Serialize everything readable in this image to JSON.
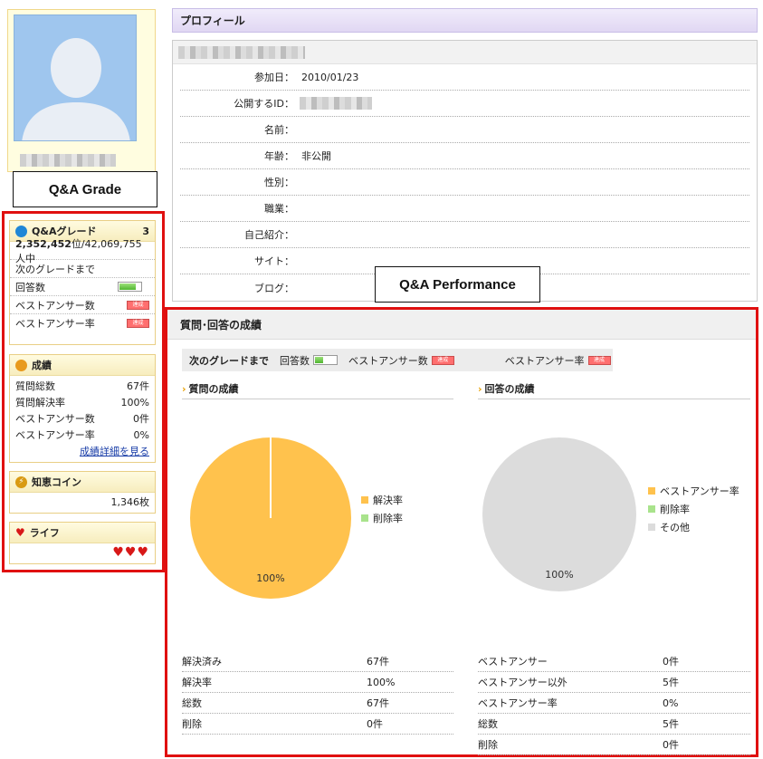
{
  "callouts": {
    "grade": "Q&A Grade",
    "performance": "Q&A Performance"
  },
  "sidebar": {
    "grade": {
      "title": "Q&Aグレード",
      "level": "3",
      "rank": "2,352,452",
      "rank_suffix": "位/42,069,755人中",
      "next_grade": "次のグレードまで",
      "rows": [
        {
          "label": "回答数",
          "indicator": "progress-bar"
        },
        {
          "label": "ベストアンサー数",
          "indicator": "badge"
        },
        {
          "label": "ベストアンサー率",
          "indicator": "badge"
        }
      ],
      "badge_text": "達成"
    },
    "results": {
      "title": "成績",
      "rows": [
        {
          "label": "質問総数",
          "value": "67件"
        },
        {
          "label": "質問解決率",
          "value": "100%"
        },
        {
          "label": "ベストアンサー数",
          "value": "0件"
        },
        {
          "label": "ベストアンサー率",
          "value": "0%"
        }
      ],
      "link": "成績詳細を見る"
    },
    "coins": {
      "title": "知恵コイン",
      "value": "1,346枚"
    },
    "life": {
      "title": "ライフ",
      "hearts": "♥♥♥"
    }
  },
  "profile": {
    "header": "プロフィール",
    "fields": [
      {
        "label": "参加日：",
        "value": "2010/01/23"
      },
      {
        "label": "公開するID：",
        "value": ""
      },
      {
        "label": "名前：",
        "value": ""
      },
      {
        "label": "年齢：",
        "value": "非公開"
      },
      {
        "label": "性別：",
        "value": ""
      },
      {
        "label": "職業：",
        "value": ""
      },
      {
        "label": "自己紹介：",
        "value": ""
      },
      {
        "label": "サイト：",
        "value": ""
      },
      {
        "label": "ブログ：",
        "value": ""
      }
    ]
  },
  "performance": {
    "title": "質問･回答の成績",
    "next_grade": {
      "label": "次のグレードまで",
      "answers": "回答数",
      "best_count": "ベストアンサー数",
      "best_rate": "ベストアンサー率"
    },
    "questions": {
      "title": "質問の成績",
      "pie_label": "100%",
      "legend": [
        {
          "label": "解決率",
          "color": "#ffc24d"
        },
        {
          "label": "削除率",
          "color": "#a9e38c"
        }
      ],
      "stats": [
        {
          "label": "解決済み",
          "value": "67件"
        },
        {
          "label": "解決率",
          "value": "100%"
        },
        {
          "label": "総数",
          "value": "67件"
        },
        {
          "label": "削除",
          "value": "0件"
        }
      ]
    },
    "answers": {
      "title": "回答の成績",
      "pie_label": "100%",
      "legend": [
        {
          "label": "ベストアンサー率",
          "color": "#ffc24d"
        },
        {
          "label": "削除率",
          "color": "#a9e38c"
        },
        {
          "label": "その他",
          "color": "#dcdcdc"
        }
      ],
      "stats": [
        {
          "label": "ベストアンサー",
          "value": "0件"
        },
        {
          "label": "ベストアンサー以外",
          "value": "5件"
        },
        {
          "label": "ベストアンサー率",
          "value": "0%"
        },
        {
          "label": "総数",
          "value": "5件"
        },
        {
          "label": "削除",
          "value": "0件"
        }
      ]
    }
  },
  "colors": {
    "accent_red": "#e01010",
    "pie_yellow": "#ffc24d",
    "pie_gray": "#dcdcdc",
    "legend_green": "#a9e38c"
  }
}
